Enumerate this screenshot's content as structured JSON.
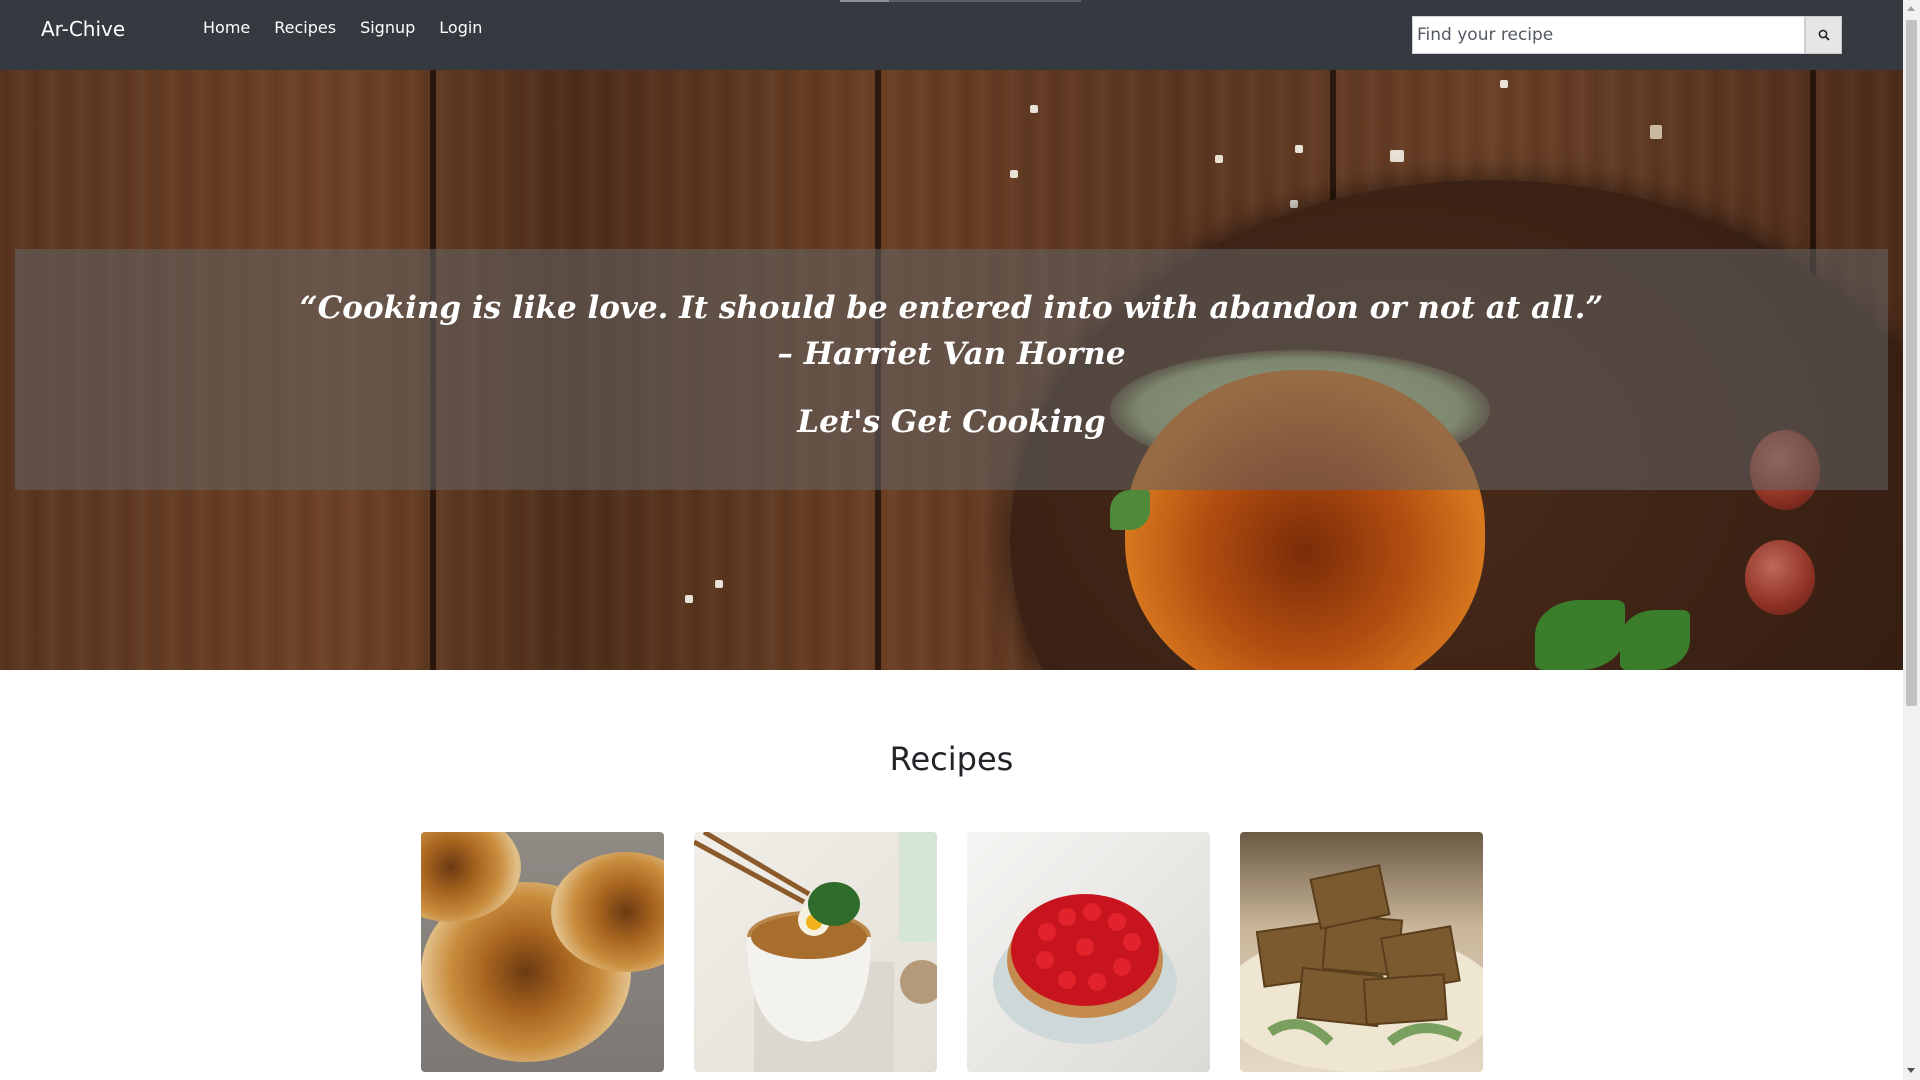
{
  "navbar": {
    "brand": "Ar-Chive",
    "links": [
      "Home",
      "Recipes",
      "Signup",
      "Login"
    ],
    "search": {
      "placeholder": "Find your recipe",
      "icon": "search-icon"
    }
  },
  "hero": {
    "quote": "“Cooking is like love. It should be entered into with abandon or not at all.”",
    "author": "– Harriet Van Horne",
    "cta": "Let's Get Cooking"
  },
  "recipes": {
    "title": "Recipes",
    "cards": [
      {
        "image": "cinnamon-roll-pancakes-image"
      },
      {
        "image": "ramen-bowl-image"
      },
      {
        "image": "strawberry-tart-image"
      },
      {
        "image": "granola-bars-image"
      }
    ]
  },
  "colors": {
    "navbar": "#343a40",
    "text_light": "#ffffff",
    "text_dark": "#212529"
  }
}
